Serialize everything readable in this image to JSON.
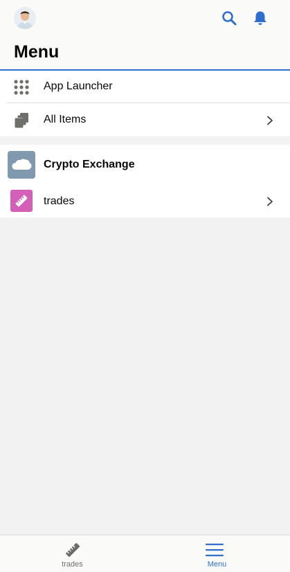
{
  "header": {
    "title": "Menu"
  },
  "menu": {
    "app_launcher_label": "App Launcher",
    "all_items_label": "All Items"
  },
  "app": {
    "name": "Crypto Exchange",
    "items": [
      {
        "label": "trades"
      }
    ]
  },
  "tabbar": {
    "tabs": [
      {
        "label": "trades",
        "active": false
      },
      {
        "label": "Menu",
        "active": true
      }
    ]
  },
  "colors": {
    "accent": "#2e6fce",
    "app_tile": "#8199af",
    "trades_tile": "#d35fb8"
  },
  "icons": {
    "avatar": "user-avatar",
    "search": "search-icon",
    "bell": "bell-icon",
    "app_launcher": "grid-icon",
    "all_items": "stacked-items-icon",
    "chevron": "chevron-right-icon",
    "app_logo": "cloud-icon",
    "trades": "ruler-icon",
    "menu": "hamburger-icon"
  }
}
